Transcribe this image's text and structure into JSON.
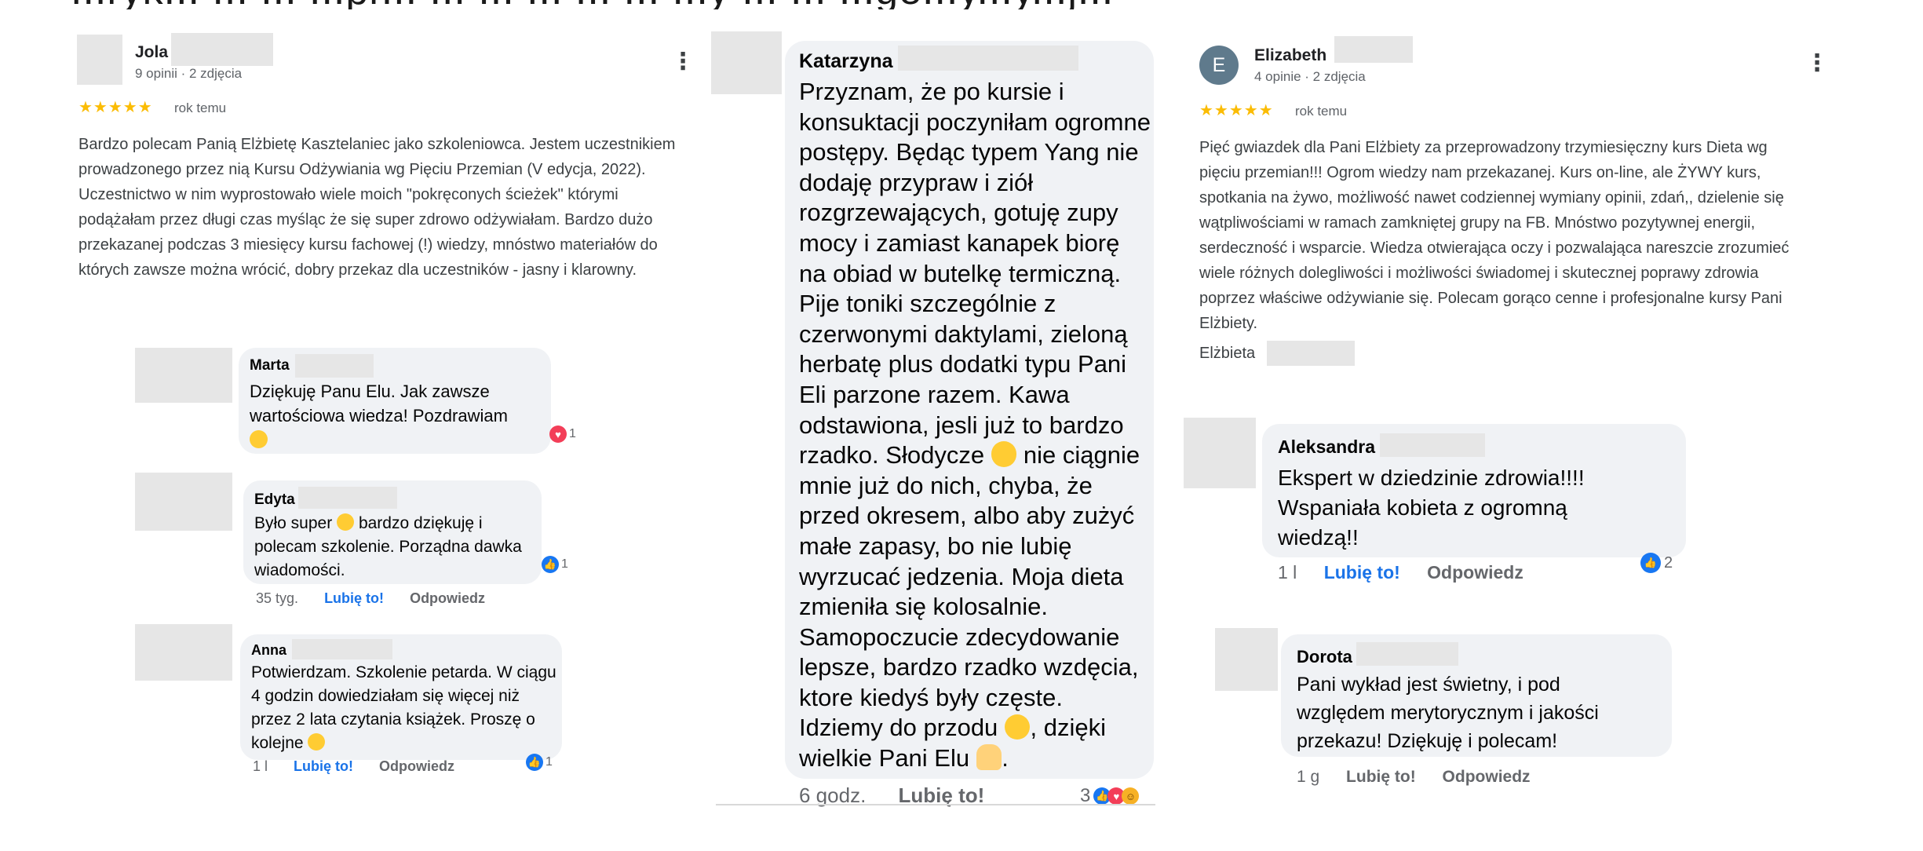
{
  "header_fragment": "...ryk... ... ... ...pr... ... ... ... ... ... ...y ... ... ...ge...y...y...j...",
  "colors": {
    "star": "#fbbc04",
    "fb_like": "#1877f2",
    "fb_love": "#f33e58",
    "bubble": "#f0f2f5",
    "link_blue": "#1a73e8"
  },
  "review1": {
    "name": "Jola",
    "meta": "9 opinii · 2 zdjęcia",
    "stars": "★★★★★",
    "ago": "rok temu",
    "text": "Bardzo polecam Panią Elżbietę Kasztelaniec jako szkoleniowca. Jestem uczestnikiem prowadzonego przez nią Kursu Odżywiania wg Pięciu Przemian (V edycja, 2022). Uczestnictwo w nim wyprostowało wiele moich \"pokręconych ścieżek\" którymi podążałam przez długi czas myśląc że się super zdrowo odżywiałam. Bardzo dużo przekazanej podczas 3 miesięcy kursu fachowej (!) wiedzy, mnóstwo materiałów do których zawsze można wrócić, dobry przekaz dla uczestników - jasny i klarowny.",
    "menu": "⋮"
  },
  "comment_marta": {
    "name": "Marta",
    "text": "Dziękuję Panu Elu. Jak zawsze wartościowa wiedza! Pozdrawiam",
    "emoji": "kiss-emoji",
    "reactions": "1"
  },
  "comment_edyta": {
    "name": "Edyta",
    "text_before": "Było super",
    "text_after": "bardzo dziękuję i polecam szkolenie. Porządna dawka wiadomości.",
    "reactions": "1",
    "time": "35 tyg.",
    "like": "Lubię to!",
    "reply": "Odpowiedz"
  },
  "comment_anna": {
    "name": "Anna",
    "text": "Potwierdzam. Szkolenie petarda. W ciągu 4 godzin dowiedziałam się więcej niż przez 2 lata czytania książek. Proszę o kolejne",
    "reactions": "1",
    "time": "1 l",
    "like": "Lubię to!",
    "reply": "Odpowiedz"
  },
  "comment_katarzyna": {
    "name": "Katarzyna",
    "text_1": "Przyznam, że po kursie i konsuktacji poczyniłam ogromne postępy. Będąc typem Yang nie dodaję przypraw i ziół rozgrzewających, gotuję zupy mocy i zamiast kanapek biorę na obiad w butelkę termiczną. Pije toniki szczególnie z czerwonymi daktylami, zieloną herbatę plus dodatki typu Pani Eli parzone razem. Kawa odstawiona, jesli już to bardzo rzadko. Słodycze",
    "text_2": "nie ciągnie mnie już do nich, chyba, że przed okresem, albo aby zużyć małe zapasy, bo nie lubię wyrzucać jedzenia. Moja dieta zmieniła się kolosalnie. Samopoczucie zdecydowanie lepsze, bardzo rzadko wzdęcia, ktore kiedyś były częste. Idziemy do przodu",
    "text_3": ", dzięki wielkie Pani Elu",
    "text_4": ".",
    "time": "6 godz.",
    "like": "Lubię to!",
    "reactions": "3"
  },
  "review2": {
    "avatar_letter": "E",
    "name": "Elizabeth",
    "meta": "4 opinie · 2 zdjęcia",
    "stars": "★★★★★",
    "ago": "rok temu",
    "text": "Pięć gwiazdek dla Pani Elżbiety za przeprowadzony trzymiesięczny kurs Dieta wg pięciu przemian!!! Ogrom wiedzy nam przekazanej. Kurs on-line, ale ŻYWY kurs, spotkania na żywo, możliwość nawet codziennej wymiany opinii, zdań,, dzielenie się wątpliwościami w ramach zamkniętej grupy na FB. Mnóstwo pozytywnej energii, serdeczność i wsparcie. Wiedza otwierająca oczy i pozwalająca nareszcie zrozumieć wiele różnych dolegliwości i możliwości świadomej i skutecznej poprawy zdrowia poprzez właściwe odżywianie się. Polecam gorąco cenne i profesjonalne kursy Pani Elżbiety.",
    "signature": "Elżbieta",
    "menu": "⋮"
  },
  "comment_aleksandra": {
    "name": "Aleksandra",
    "text": "Ekspert w dziedzinie zdrowia!!!! Wspaniała kobieta z ogromną wiedzą!!",
    "time": "1 l",
    "like": "Lubię to!",
    "reply": "Odpowiedz",
    "reactions": "2"
  },
  "comment_dorota": {
    "name": "Dorota",
    "text": "Pani wykład jest świetny, i pod względem merytorycznym i jakości przekazu! Dziękuję i polecam!",
    "time": "1 g",
    "like": "Lubię to!",
    "reply": "Odpowiedz"
  }
}
